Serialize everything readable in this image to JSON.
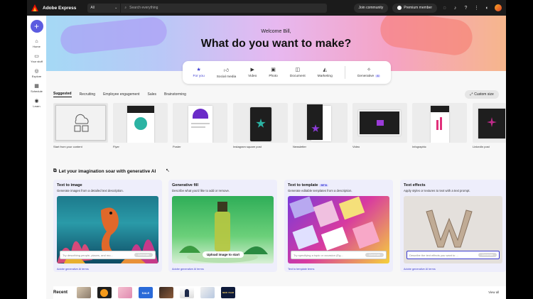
{
  "app": {
    "title": "Adobe Express"
  },
  "topbar": {
    "scope": "All",
    "search_placeholder": "Search everything",
    "join_community": "Join community",
    "premium": "Premium member"
  },
  "rail": {
    "items": [
      {
        "label": "Home",
        "icon": "home-icon"
      },
      {
        "label": "Your stuff",
        "icon": "folder-icon"
      },
      {
        "label": "Explore",
        "icon": "compass-icon"
      },
      {
        "label": "Schedule",
        "icon": "calendar-icon"
      },
      {
        "label": "Learn",
        "icon": "bulb-icon"
      }
    ]
  },
  "hero": {
    "welcome": "Welcome Bill,",
    "headline": "What do you want to make?"
  },
  "categories": [
    {
      "label": "For you",
      "icon": "star-icon"
    },
    {
      "label": "Social media",
      "icon": "thumbs-up-icon"
    },
    {
      "label": "Video",
      "icon": "play-icon"
    },
    {
      "label": "Photo",
      "icon": "image-icon"
    },
    {
      "label": "Document",
      "icon": "document-icon"
    },
    {
      "label": "Marketing",
      "icon": "megaphone-icon"
    },
    {
      "label": "Generative",
      "icon": "sparkle-icon",
      "badge": "AI"
    }
  ],
  "filters": {
    "tabs": [
      "Suggested",
      "Recruiting",
      "Employee engagement",
      "Sales",
      "Brainstorming"
    ],
    "custom_size": "Custom size"
  },
  "templates": [
    "Start from your content",
    "Flyer",
    "Poster",
    "Instagram square post",
    "Newsletter",
    "Video",
    "Infographic",
    "LinkedIn post"
  ],
  "genai": {
    "heading": "Let your imagination soar with generative AI",
    "cards": [
      {
        "title": "Text to image",
        "desc": "Generate images from a detailed text description.",
        "placeholder": "Try describing people, places, and mo...",
        "button": "Generate",
        "terms": "Adobe generative AI terms"
      },
      {
        "title": "Generative fill",
        "desc": "Describe what you'd like to add or remove.",
        "upload": "Upload image to start",
        "terms": "Adobe generative AI terms"
      },
      {
        "title": "Text to template",
        "badge": "BETA",
        "desc": "Generate editable templates from a description.",
        "placeholder": "Try specifying a topic or occasion (Eg...",
        "button": "Generate",
        "terms": "Text to template terms"
      },
      {
        "title": "Text effects",
        "desc": "Apply styles or textures to text with a text prompt.",
        "placeholder": "Describe the text effects you want to ...",
        "button": "Generate",
        "terms": "Adobe generative AI terms"
      }
    ]
  },
  "recent": {
    "label": "Recent",
    "view_all": "View all",
    "thumb_texts": [
      "SALE",
      "NEW YEAR"
    ]
  },
  "colors": {
    "accent": "#3b3bd0",
    "plus_button": "#5c5ce0",
    "topbar": "#1b1b1b"
  }
}
